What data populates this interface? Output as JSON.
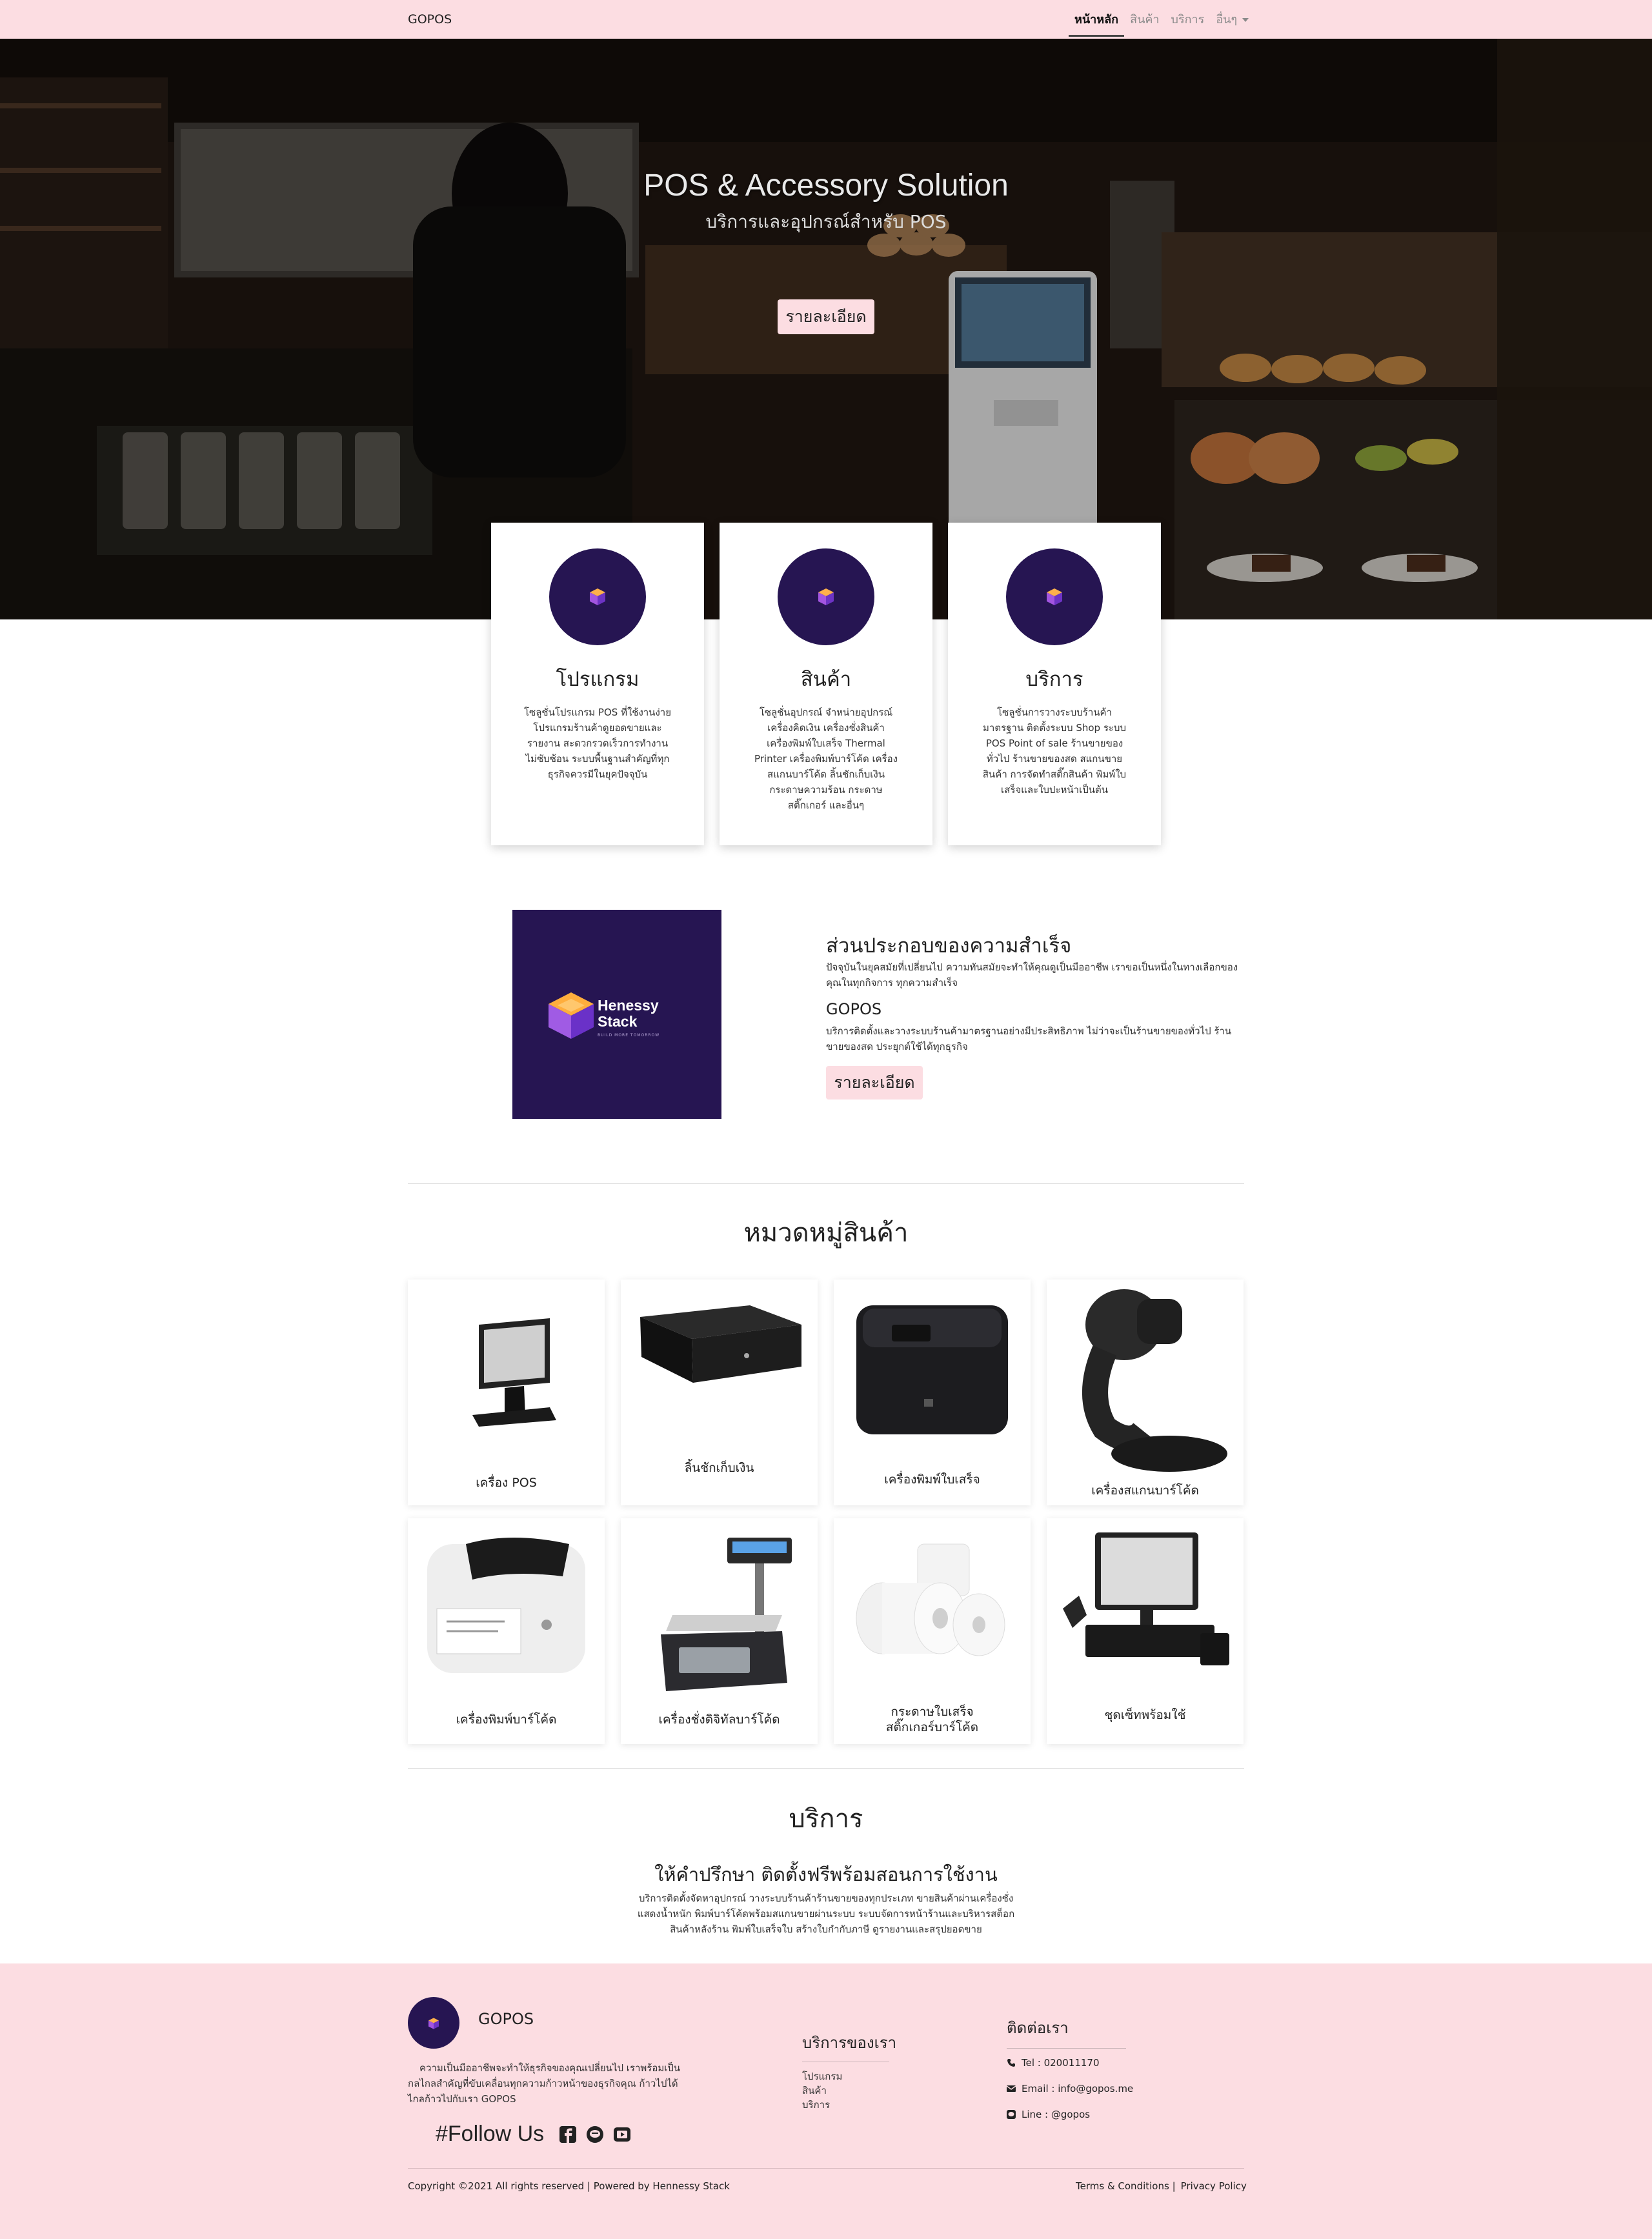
{
  "nav": {
    "brand": "GOPOS",
    "links": [
      "หน้าหลัก",
      "สินค้า",
      "บริการ",
      "อื่นๆ"
    ]
  },
  "hero": {
    "title": "POS & Accessory Solution",
    "subtitle": "บริการและอุปกรณ์สำหรับ POS",
    "button": "รายละเอียด"
  },
  "features": [
    {
      "title": "โปรแกรม",
      "text": "โซลูชั่นโปรแกรม POS ที่ใช้งานง่าย โปรแกรมร้านค้าดูยอดขายและรายงาน สะดวกรวดเร็วการทำงานไม่ซับซ้อน ระบบพื้นฐานสำคัญที่ทุกธุรกิจควรมีในยุคปัจจุบัน"
    },
    {
      "title": "สินค้า",
      "text": "โซลูชั่นอุปกรณ์ จำหน่ายอุปกรณ์ เครื่องคิดเงิน เครื่องชั่งสินค้า เครื่องพิมพ์ใบเสร็จ Thermal Printer เครื่องพิมพ์บาร์โค้ด เครื่องสแกนบาร์โค้ด ลิ้นชักเก็บเงิน กระดาษความร้อน กระดาษสติ๊กเกอร์ และอื่นๆ"
    },
    {
      "title": "บริการ",
      "text": "โซลูชั่นการวางระบบร้านค้ามาตรฐาน ติดตั้งระบบ Shop ระบบ POS Point of sale ร้านขายของทั่วไป ร้านขายของสด สแกนขายสินค้า การจัดทำสติ๊กสินค้า พิมพ์ใบเสร็จและใบปะหน้าเป็นต้น"
    }
  ],
  "success": {
    "logo_name_1": "Henessy",
    "logo_name_2": "Stack",
    "logo_tagline": "BUILD MORE TOMORROW",
    "title": "ส่วนประกอบของความสำเร็จ",
    "p1": "ปัจจุบันในยุคสมัยที่เปลี่ยนไป ความทันสมัยจะทำให้คุณดูเป็นมืออาชีพ เราขอเป็นหนึ่งในทางเลือกของคุณในทุกกิจการ ทุกความสำเร็จ",
    "subtitle": "GOPOS",
    "p2": "บริการติดตั้งและวางระบบร้านค้ามาตรฐานอย่างมีประสิทธิภาพ ไม่ว่าจะเป็นร้านขายของทั่วไป ร้านขายของสด ประยุกต์ใช้ได้ทุกธุรกิจ",
    "button": "รายละเอียด"
  },
  "categories": {
    "title": "หมวดหมู่สินค้า",
    "items": [
      {
        "label": "เครื่อง POS"
      },
      {
        "label": "ลิ้นชักเก็บเงิน"
      },
      {
        "label": "เครื่องพิมพ์ใบเสร็จ"
      },
      {
        "label": "เครื่องสแกนบาร์โค้ด"
      },
      {
        "label": "เครื่องพิมพ์บาร์โค้ด"
      },
      {
        "label": "เครื่องชั่งดิจิทัลบาร์โค้ด"
      },
      {
        "label": "กระดาษใบเสร็จ",
        "label2": "สติ๊กเกอร์บาร์โค้ด"
      },
      {
        "label": "ชุดเซ็ทพร้อมใช้"
      }
    ]
  },
  "service": {
    "title": "บริการ",
    "heading": "ให้คำปรึกษา ติดตั้งฟรีพร้อมสอนการใช้งาน",
    "text": "บริการติดตั้งจัดหาอุปกรณ์ วางระบบร้านค้าร้านขายของทุกประเภท ขายสินค้าผ่านเครื่องชั่ง แสดงน้ำหนัก พิมพ์บาร์โค้ดพร้อมสแกนขายผ่านระบบ ระบบจัดการหน้าร้านและบริหารสต็อกสินค้าหลังร้าน พิมพ์ใบเสร็จใบ สร้างใบกำกับภาษี ดูรายงานและสรุปยอดขาย"
  },
  "footer": {
    "brand": "GOPOS",
    "about": "ความเป็นมืออาชีพจะทำให้ธุรกิจของคุณเปลี่ยนไป เราพร้อมเป็นกลไกลสำคัญที่ขับเคลื่อนทุกความก้าวหน้าของธุรกิจคุณ ก้าวไปได้ไกลก้าวไปกับเรา GOPOS",
    "follow": "#Follow Us",
    "services_title": "บริการของเรา",
    "service_links": [
      "โปรแกรม",
      "สินค้า",
      "บริการ"
    ],
    "contact_title": "ติดต่อเรา",
    "tel": "Tel : 020011170",
    "email": "Email : info@gopos.me",
    "line": "Line : @gopos",
    "copyright": "Copyright ©2021 All rights reserved | Powered by Hennessy Stack",
    "terms": "Terms & Conditions |",
    "privacy": "Privacy Policy"
  }
}
